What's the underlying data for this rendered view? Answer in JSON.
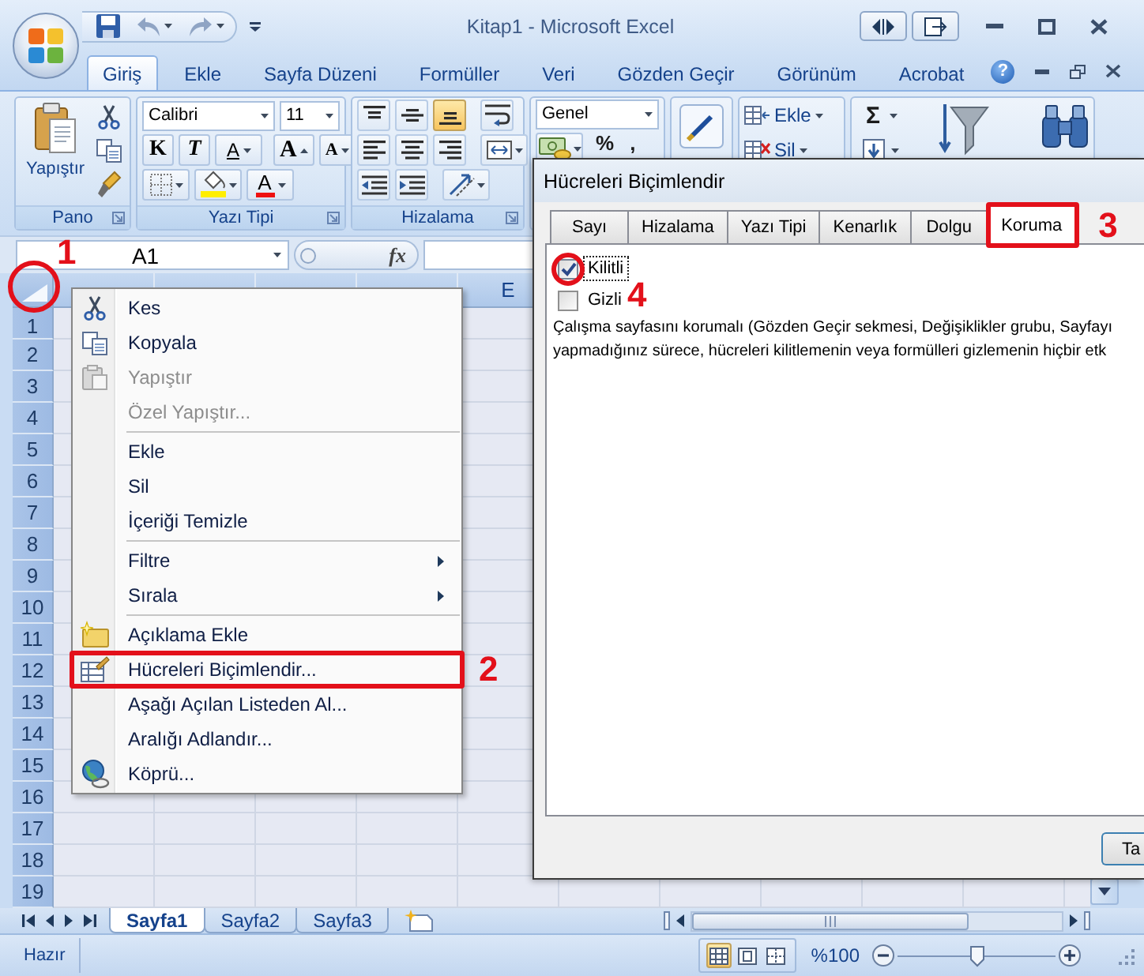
{
  "window": {
    "title": "Kitap1 - Microsoft Excel"
  },
  "ribbon_tabs": [
    {
      "label": "Giriş",
      "selected": true
    },
    {
      "label": "Ekle",
      "selected": false
    },
    {
      "label": "Sayfa Düzeni",
      "selected": false
    },
    {
      "label": "Formüller",
      "selected": false
    },
    {
      "label": "Veri",
      "selected": false
    },
    {
      "label": "Gözden Geçir",
      "selected": false
    },
    {
      "label": "Görünüm",
      "selected": false
    },
    {
      "label": "Acrobat",
      "selected": false
    }
  ],
  "ribbon_help": "?",
  "clipboard_group": {
    "label": "Pano",
    "paste": "Yapıştır"
  },
  "font_group": {
    "label": "Yazı Tipi",
    "font_name": "Calibri",
    "font_size": "11",
    "bold": "K",
    "italic": "T",
    "underline": "A",
    "grow": "A",
    "shrink": "A",
    "font_color": "A"
  },
  "alignment_group": {
    "label": "Hizalama",
    "vertical": [
      {
        "kind": "top",
        "selected": false
      },
      {
        "kind": "middle",
        "selected": false
      },
      {
        "kind": "bottom",
        "selected": true
      }
    ],
    "horizontal": [
      {
        "kind": "left",
        "selected": false
      },
      {
        "kind": "center",
        "selected": false
      },
      {
        "kind": "right",
        "selected": false
      }
    ]
  },
  "number_group": {
    "format": "Genel",
    "percent": "%",
    "comma": ","
  },
  "cells_group": {
    "insert": "Ekle",
    "delete": "Sil"
  },
  "editing_group": {
    "sum": "Σ"
  },
  "formula_bar": {
    "name_box": "A1",
    "function_button": "fx"
  },
  "sheet": {
    "select_all_callout": "1",
    "columns": [
      "E"
    ],
    "rows": [
      "1",
      "2",
      "3",
      "4",
      "5",
      "6",
      "7",
      "8",
      "9",
      "10",
      "11",
      "12",
      "13",
      "14",
      "15",
      "16",
      "17",
      "18",
      "19"
    ]
  },
  "context_menu": {
    "sections": [
      {
        "items": [
          {
            "kind": "cut",
            "label": "Kes",
            "disabled": false,
            "submenu": false
          },
          {
            "kind": "copy",
            "label": "Kopyala",
            "disabled": false,
            "submenu": false
          },
          {
            "kind": "paste",
            "label": "Yapıştır",
            "disabled": true,
            "submenu": false
          },
          {
            "kind": "text",
            "label": "Özel Yapıştır...",
            "disabled": true,
            "submenu": false
          }
        ]
      },
      {
        "items": [
          {
            "kind": "text",
            "label": "Ekle",
            "disabled": false,
            "submenu": false
          },
          {
            "kind": "text",
            "label": "Sil",
            "disabled": false,
            "submenu": false
          },
          {
            "kind": "text",
            "label": "İçeriği Temizle",
            "disabled": false,
            "submenu": false
          }
        ]
      },
      {
        "items": [
          {
            "kind": "text",
            "label": "Filtre",
            "disabled": false,
            "submenu": true
          },
          {
            "kind": "text",
            "label": "Sırala",
            "disabled": false,
            "submenu": true
          }
        ]
      },
      {
        "items": [
          {
            "kind": "note",
            "label": "Açıklama Ekle",
            "disabled": false,
            "submenu": false
          },
          {
            "kind": "format",
            "label": "Hücreleri Biçimlendir...",
            "disabled": false,
            "submenu": false,
            "callout": "2"
          },
          {
            "kind": "text",
            "label": "Aşağı Açılan Listeden Al...",
            "disabled": false,
            "submenu": false
          },
          {
            "kind": "text",
            "label": "Aralığı Adlandır...",
            "disabled": false,
            "submenu": false
          },
          {
            "kind": "link",
            "label": "Köprü...",
            "disabled": false,
            "submenu": false
          }
        ]
      }
    ]
  },
  "dialog": {
    "title": "Hücreleri Biçimlendir",
    "tabs": [
      {
        "label": "Sayı",
        "selected": false
      },
      {
        "label": "Hizalama",
        "selected": false
      },
      {
        "label": "Yazı Tipi",
        "selected": false
      },
      {
        "label": "Kenarlık",
        "selected": false
      },
      {
        "label": "Dolgu",
        "selected": false
      },
      {
        "label": "Koruma",
        "selected": true,
        "callout": "3"
      }
    ],
    "checkboxes": [
      {
        "label": "Kilitli",
        "checked": true,
        "focused": true,
        "callout": "4"
      },
      {
        "label": "Gizli",
        "checked": false,
        "focused": false
      }
    ],
    "description_lines": [
      "Çalışma sayfasını korumalı (Gözden Geçir sekmesi, Değişiklikler grubu, Sayfayı",
      "yapmadığınız sürece, hücreleri kilitlemenin veya formülleri gizlemenin hiçbir etk"
    ],
    "button": "Ta"
  },
  "sheet_tabs": [
    {
      "label": "Sayfa1",
      "selected": true
    },
    {
      "label": "Sayfa2",
      "selected": false
    },
    {
      "label": "Sayfa3",
      "selected": false
    }
  ],
  "status_bar": {
    "status": "Hazır",
    "views": [
      {
        "kind": "normal",
        "selected": true
      },
      {
        "kind": "page_layout",
        "selected": false
      },
      {
        "kind": "page_break",
        "selected": false
      }
    ],
    "zoom_label": "%100",
    "zoom": {
      "level": 0.5
    }
  }
}
